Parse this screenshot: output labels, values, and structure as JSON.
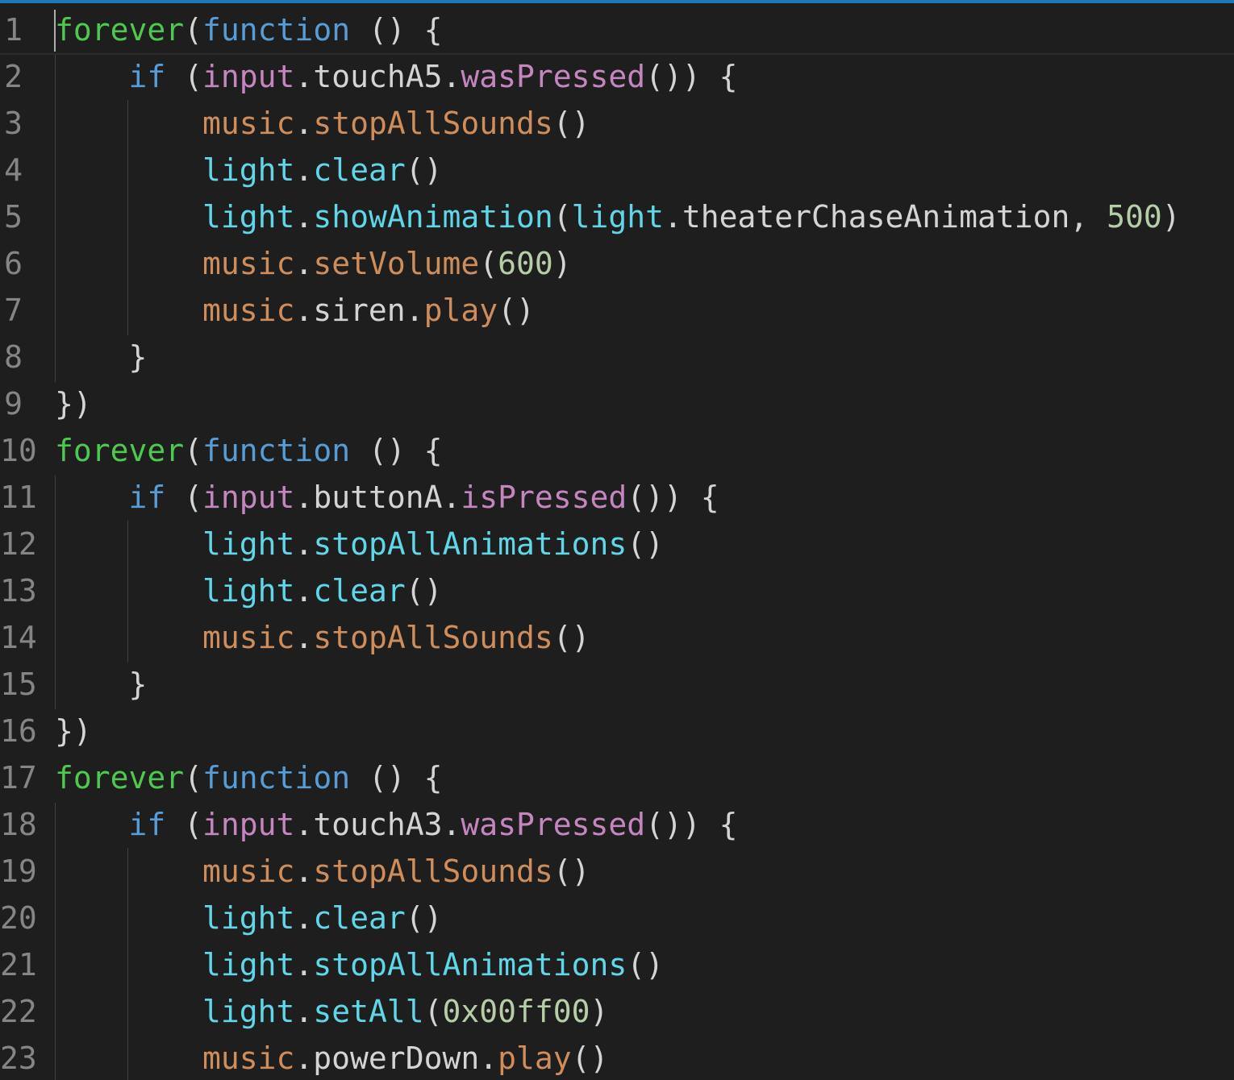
{
  "editor": {
    "accent_color": "#1f79b8",
    "background_color": "#1e1e1e",
    "line_numbers": [
      "1",
      "2",
      "3",
      "4",
      "5",
      "6",
      "7",
      "8",
      "9",
      "10",
      "11",
      "12",
      "13",
      "14",
      "15",
      "16",
      "17",
      "18",
      "19",
      "20",
      "21",
      "22",
      "23"
    ]
  },
  "code": {
    "lines": [
      [
        {
          "t": "forever",
          "c": "tok-forever"
        },
        {
          "t": "(",
          "c": "tok-punc"
        },
        {
          "t": "function",
          "c": "tok-kw"
        },
        {
          "t": " () {",
          "c": "tok-punc"
        }
      ],
      [
        {
          "t": "    ",
          "c": "tok-punc"
        },
        {
          "t": "if",
          "c": "tok-kw"
        },
        {
          "t": " (",
          "c": "tok-punc"
        },
        {
          "t": "input",
          "c": "tok-input"
        },
        {
          "t": ".touchA5.",
          "c": "tok-prop"
        },
        {
          "t": "wasPressed",
          "c": "tok-method"
        },
        {
          "t": "()) {",
          "c": "tok-punc"
        }
      ],
      [
        {
          "t": "        ",
          "c": "tok-punc"
        },
        {
          "t": "music",
          "c": "tok-music"
        },
        {
          "t": ".",
          "c": "tok-punc"
        },
        {
          "t": "stopAllSounds",
          "c": "tok-music"
        },
        {
          "t": "()",
          "c": "tok-punc"
        }
      ],
      [
        {
          "t": "        ",
          "c": "tok-punc"
        },
        {
          "t": "light",
          "c": "tok-light"
        },
        {
          "t": ".",
          "c": "tok-punc"
        },
        {
          "t": "clear",
          "c": "tok-light"
        },
        {
          "t": "()",
          "c": "tok-punc"
        }
      ],
      [
        {
          "t": "        ",
          "c": "tok-punc"
        },
        {
          "t": "light",
          "c": "tok-light"
        },
        {
          "t": ".",
          "c": "tok-punc"
        },
        {
          "t": "showAnimation",
          "c": "tok-light"
        },
        {
          "t": "(",
          "c": "tok-punc"
        },
        {
          "t": "light",
          "c": "tok-light"
        },
        {
          "t": ".theaterChaseAnimation, ",
          "c": "tok-theater"
        },
        {
          "t": "500",
          "c": "tok-num"
        },
        {
          "t": ")",
          "c": "tok-punc"
        }
      ],
      [
        {
          "t": "        ",
          "c": "tok-punc"
        },
        {
          "t": "music",
          "c": "tok-music"
        },
        {
          "t": ".",
          "c": "tok-punc"
        },
        {
          "t": "setVolume",
          "c": "tok-music"
        },
        {
          "t": "(",
          "c": "tok-punc"
        },
        {
          "t": "600",
          "c": "tok-num"
        },
        {
          "t": ")",
          "c": "tok-punc"
        }
      ],
      [
        {
          "t": "        ",
          "c": "tok-punc"
        },
        {
          "t": "music",
          "c": "tok-music"
        },
        {
          "t": ".siren.",
          "c": "tok-prop"
        },
        {
          "t": "play",
          "c": "tok-music"
        },
        {
          "t": "()",
          "c": "tok-punc"
        }
      ],
      [
        {
          "t": "    }",
          "c": "tok-punc"
        }
      ],
      [
        {
          "t": "})",
          "c": "tok-punc"
        }
      ],
      [
        {
          "t": "forever",
          "c": "tok-forever"
        },
        {
          "t": "(",
          "c": "tok-punc"
        },
        {
          "t": "function",
          "c": "tok-kw"
        },
        {
          "t": " () {",
          "c": "tok-punc"
        }
      ],
      [
        {
          "t": "    ",
          "c": "tok-punc"
        },
        {
          "t": "if",
          "c": "tok-kw"
        },
        {
          "t": " (",
          "c": "tok-punc"
        },
        {
          "t": "input",
          "c": "tok-input"
        },
        {
          "t": ".buttonA.",
          "c": "tok-prop"
        },
        {
          "t": "isPressed",
          "c": "tok-method"
        },
        {
          "t": "()) {",
          "c": "tok-punc"
        }
      ],
      [
        {
          "t": "        ",
          "c": "tok-punc"
        },
        {
          "t": "light",
          "c": "tok-light"
        },
        {
          "t": ".",
          "c": "tok-punc"
        },
        {
          "t": "stopAllAnimations",
          "c": "tok-light"
        },
        {
          "t": "()",
          "c": "tok-punc"
        }
      ],
      [
        {
          "t": "        ",
          "c": "tok-punc"
        },
        {
          "t": "light",
          "c": "tok-light"
        },
        {
          "t": ".",
          "c": "tok-punc"
        },
        {
          "t": "clear",
          "c": "tok-light"
        },
        {
          "t": "()",
          "c": "tok-punc"
        }
      ],
      [
        {
          "t": "        ",
          "c": "tok-punc"
        },
        {
          "t": "music",
          "c": "tok-music"
        },
        {
          "t": ".",
          "c": "tok-punc"
        },
        {
          "t": "stopAllSounds",
          "c": "tok-music"
        },
        {
          "t": "()",
          "c": "tok-punc"
        }
      ],
      [
        {
          "t": "    }",
          "c": "tok-punc"
        }
      ],
      [
        {
          "t": "})",
          "c": "tok-punc"
        }
      ],
      [
        {
          "t": "forever",
          "c": "tok-forever"
        },
        {
          "t": "(",
          "c": "tok-punc"
        },
        {
          "t": "function",
          "c": "tok-kw"
        },
        {
          "t": " () {",
          "c": "tok-punc"
        }
      ],
      [
        {
          "t": "    ",
          "c": "tok-punc"
        },
        {
          "t": "if",
          "c": "tok-kw"
        },
        {
          "t": " (",
          "c": "tok-punc"
        },
        {
          "t": "input",
          "c": "tok-input"
        },
        {
          "t": ".touchA3.",
          "c": "tok-prop"
        },
        {
          "t": "wasPressed",
          "c": "tok-method"
        },
        {
          "t": "()) {",
          "c": "tok-punc"
        }
      ],
      [
        {
          "t": "        ",
          "c": "tok-punc"
        },
        {
          "t": "music",
          "c": "tok-music"
        },
        {
          "t": ".",
          "c": "tok-punc"
        },
        {
          "t": "stopAllSounds",
          "c": "tok-music"
        },
        {
          "t": "()",
          "c": "tok-punc"
        }
      ],
      [
        {
          "t": "        ",
          "c": "tok-punc"
        },
        {
          "t": "light",
          "c": "tok-light"
        },
        {
          "t": ".",
          "c": "tok-punc"
        },
        {
          "t": "clear",
          "c": "tok-light"
        },
        {
          "t": "()",
          "c": "tok-punc"
        }
      ],
      [
        {
          "t": "        ",
          "c": "tok-punc"
        },
        {
          "t": "light",
          "c": "tok-light"
        },
        {
          "t": ".",
          "c": "tok-punc"
        },
        {
          "t": "stopAllAnimations",
          "c": "tok-light"
        },
        {
          "t": "()",
          "c": "tok-punc"
        }
      ],
      [
        {
          "t": "        ",
          "c": "tok-punc"
        },
        {
          "t": "light",
          "c": "tok-light"
        },
        {
          "t": ".",
          "c": "tok-punc"
        },
        {
          "t": "setAll",
          "c": "tok-light"
        },
        {
          "t": "(",
          "c": "tok-punc"
        },
        {
          "t": "0x00ff00",
          "c": "tok-num"
        },
        {
          "t": ")",
          "c": "tok-punc"
        }
      ],
      [
        {
          "t": "        ",
          "c": "tok-punc"
        },
        {
          "t": "music",
          "c": "tok-music"
        },
        {
          "t": ".powerDown.",
          "c": "tok-prop"
        },
        {
          "t": "play",
          "c": "tok-music"
        },
        {
          "t": "()",
          "c": "tok-punc"
        }
      ]
    ]
  }
}
